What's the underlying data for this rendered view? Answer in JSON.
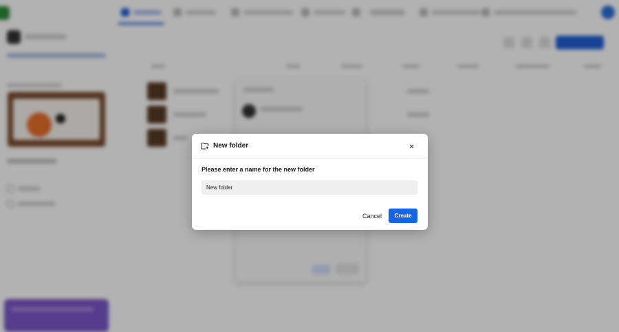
{
  "modal": {
    "title": "New folder",
    "prompt": "Please enter a name for the new folder",
    "input_value": "New folder",
    "cancel_label": "Cancel",
    "create_label": "Create",
    "accent_color": "#1565e6",
    "icons": {
      "title": "folder-plus-icon",
      "close": "close-icon"
    }
  },
  "overlay_color": "rgba(0,0,0,0.30)"
}
